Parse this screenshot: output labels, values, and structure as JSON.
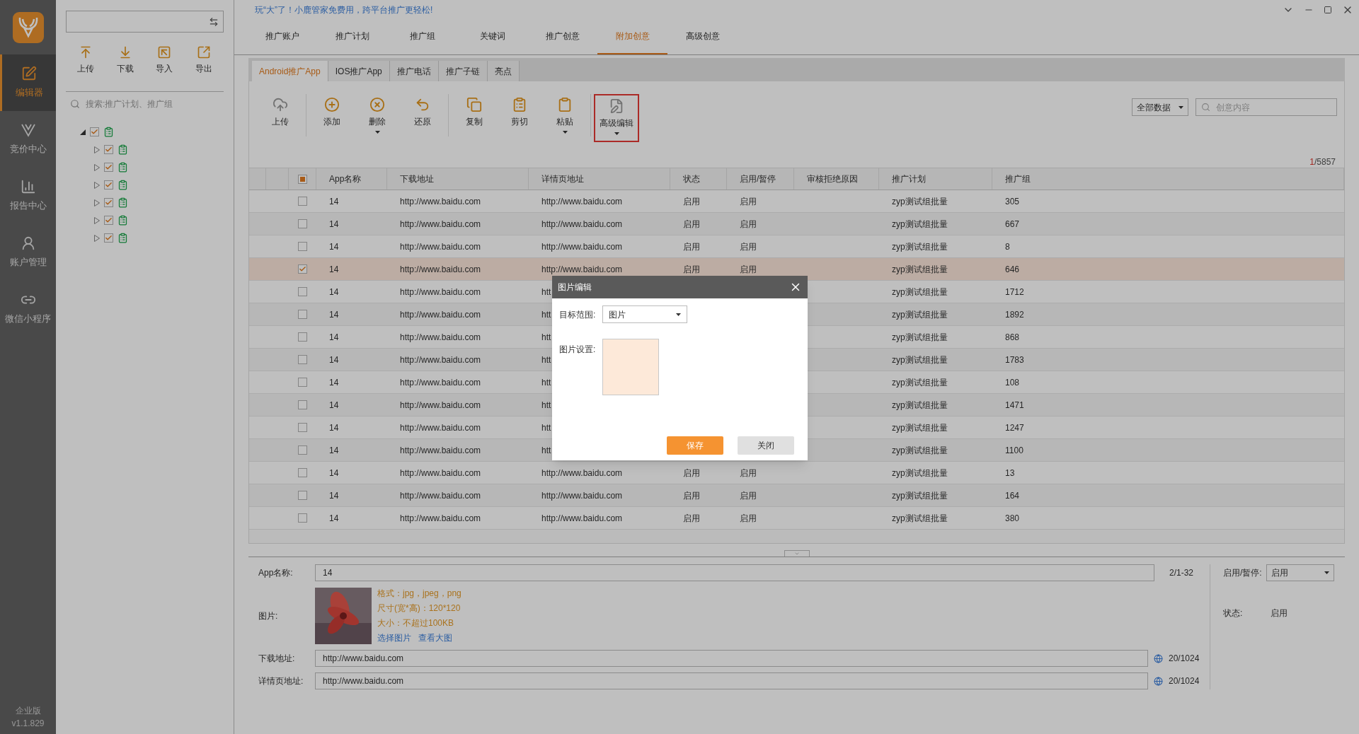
{
  "sidebar": {
    "items": [
      {
        "label": "编辑器",
        "selected": true
      },
      {
        "label": "竞价中心",
        "selected": false
      },
      {
        "label": "报告中心",
        "selected": false
      },
      {
        "label": "账户管理",
        "selected": false
      },
      {
        "label": "微信小程序",
        "selected": false
      }
    ],
    "edition": "企业版",
    "version": "v1.1.829"
  },
  "tree_panel": {
    "toolbar": [
      "上传",
      "下载",
      "导入",
      "导出"
    ],
    "search": {
      "placeholder": "搜索:推广计划、推广组"
    },
    "tree": [
      {
        "checked": true,
        "expanded": true,
        "children": [
          {
            "checked": true,
            "expanded": false
          },
          {
            "checked": true,
            "expanded": false
          },
          {
            "checked": true,
            "expanded": false
          },
          {
            "checked": true,
            "expanded": false
          },
          {
            "checked": true,
            "expanded": false
          },
          {
            "checked": true,
            "expanded": false
          }
        ]
      }
    ]
  },
  "banner": "玩“大”了！小鹿管家免费用，跨平台推广更轻松!",
  "tabs": [
    {
      "label": "推广账户",
      "selected": false
    },
    {
      "label": "推广计划",
      "selected": false
    },
    {
      "label": "推广组",
      "selected": false
    },
    {
      "label": "关键词",
      "selected": false
    },
    {
      "label": "推广创意",
      "selected": false
    },
    {
      "label": "附加创意",
      "selected": true
    },
    {
      "label": "高级创意",
      "selected": false
    }
  ],
  "sub_tabs": [
    {
      "label": "Android推广App",
      "selected": true
    },
    {
      "label": "IOS推广App",
      "selected": false
    },
    {
      "label": "推广电话",
      "selected": false
    },
    {
      "label": "推广子链",
      "selected": false
    },
    {
      "label": "亮点",
      "selected": false
    }
  ],
  "toolbar": [
    {
      "label": "上传",
      "dropdown": false,
      "highlighted": false
    },
    {
      "label": "添加",
      "dropdown": false,
      "highlighted": false
    },
    {
      "label": "删除",
      "dropdown": true,
      "highlighted": false
    },
    {
      "label": "还原",
      "dropdown": false,
      "highlighted": false
    },
    {
      "label": "复制",
      "dropdown": false,
      "highlighted": false
    },
    {
      "label": "剪切",
      "dropdown": false,
      "highlighted": false
    },
    {
      "label": "粘贴",
      "dropdown": true,
      "highlighted": false
    },
    {
      "label": "高级编辑",
      "dropdown": true,
      "highlighted": true
    }
  ],
  "filter": {
    "value": "全部数据"
  },
  "search": {
    "placeholder": "创意内容"
  },
  "pager": {
    "current": "1",
    "total": "/5857"
  },
  "table": {
    "header_checkbox_partial": true,
    "columns": [
      "App名称",
      "下载地址",
      "详情页地址",
      "状态",
      "启用/暂停",
      "审核拒绝原因",
      "推广计划",
      "推广组"
    ],
    "rows": [
      {
        "selected": false,
        "name": "14",
        "download": "http://www.baidu.com",
        "detail": "http://www.baidu.com",
        "status": "启用",
        "enable": "启用",
        "plan": "zyp测试组批量",
        "group": "305"
      },
      {
        "selected": false,
        "name": "14",
        "download": "http://www.baidu.com",
        "detail": "http://www.baidu.com",
        "status": "启用",
        "enable": "启用",
        "plan": "zyp测试组批量",
        "group": "667"
      },
      {
        "selected": false,
        "name": "14",
        "download": "http://www.baidu.com",
        "detail": "http://www.baidu.com",
        "status": "启用",
        "enable": "启用",
        "plan": "zyp测试组批量",
        "group": "8"
      },
      {
        "selected": true,
        "name": "14",
        "download": "http://www.baidu.com",
        "detail": "http://www.baidu.com",
        "status": "启用",
        "enable": "启用",
        "plan": "zyp测试组批量",
        "group": "646"
      },
      {
        "selected": false,
        "name": "14",
        "download": "http://www.baidu.com",
        "detail": "htt",
        "plan": "zyp测试组批量",
        "group": "1712"
      },
      {
        "selected": false,
        "name": "14",
        "download": "http://www.baidu.com",
        "detail": "htt",
        "plan": "zyp测试组批量",
        "group": "1892"
      },
      {
        "selected": false,
        "name": "14",
        "download": "http://www.baidu.com",
        "detail": "htt",
        "plan": "zyp测试组批量",
        "group": "868"
      },
      {
        "selected": false,
        "name": "14",
        "download": "http://www.baidu.com",
        "detail": "htt",
        "plan": "zyp测试组批量",
        "group": "1783"
      },
      {
        "selected": false,
        "name": "14",
        "download": "http://www.baidu.com",
        "detail": "htt",
        "plan": "zyp测试组批量",
        "group": "108"
      },
      {
        "selected": false,
        "name": "14",
        "download": "http://www.baidu.com",
        "detail": "htt",
        "plan": "zyp测试组批量",
        "group": "1471"
      },
      {
        "selected": false,
        "name": "14",
        "download": "http://www.baidu.com",
        "detail": "htt",
        "plan": "zyp测试组批量",
        "group": "1247"
      },
      {
        "selected": false,
        "name": "14",
        "download": "http://www.baidu.com",
        "detail": "htt",
        "plan": "zyp测试组批量",
        "group": "1100"
      },
      {
        "selected": false,
        "name": "14",
        "download": "http://www.baidu.com",
        "detail": "http://www.baidu.com",
        "status": "启用",
        "enable": "启用",
        "plan": "zyp测试组批量",
        "group": "13"
      },
      {
        "selected": false,
        "name": "14",
        "download": "http://www.baidu.com",
        "detail": "http://www.baidu.com",
        "status": "启用",
        "enable": "启用",
        "plan": "zyp测试组批量",
        "group": "164"
      },
      {
        "selected": false,
        "name": "14",
        "download": "http://www.baidu.com",
        "detail": "http://www.baidu.com",
        "status": "启用",
        "enable": "启用",
        "plan": "zyp测试组批量",
        "group": "380"
      }
    ]
  },
  "form": {
    "app_name": {
      "label": "App名称:",
      "value": "14",
      "count": "2/1-32"
    },
    "image": {
      "label": "图片:",
      "hints": [
        "格式：jpg，jpeg，png",
        "尺寸(宽*高)：120*120",
        "大小：不超过100KB"
      ],
      "links": [
        "选择图片",
        "查看大图"
      ]
    },
    "download": {
      "label": "下载地址:",
      "value": "http://www.baidu.com",
      "count": "20/1024"
    },
    "detail": {
      "label": "详情页地址:",
      "value": "http://www.baidu.com",
      "count": "20/1024"
    },
    "enable": {
      "label": "启用/暂停:",
      "value": "启用"
    },
    "status": {
      "label": "状态:",
      "value": "启用"
    }
  },
  "dialog": {
    "title": "图片编辑",
    "target": {
      "label": "目标范围:",
      "value": "图片"
    },
    "image_label": "图片设置:",
    "buttons": [
      "保存",
      "关闭"
    ]
  }
}
